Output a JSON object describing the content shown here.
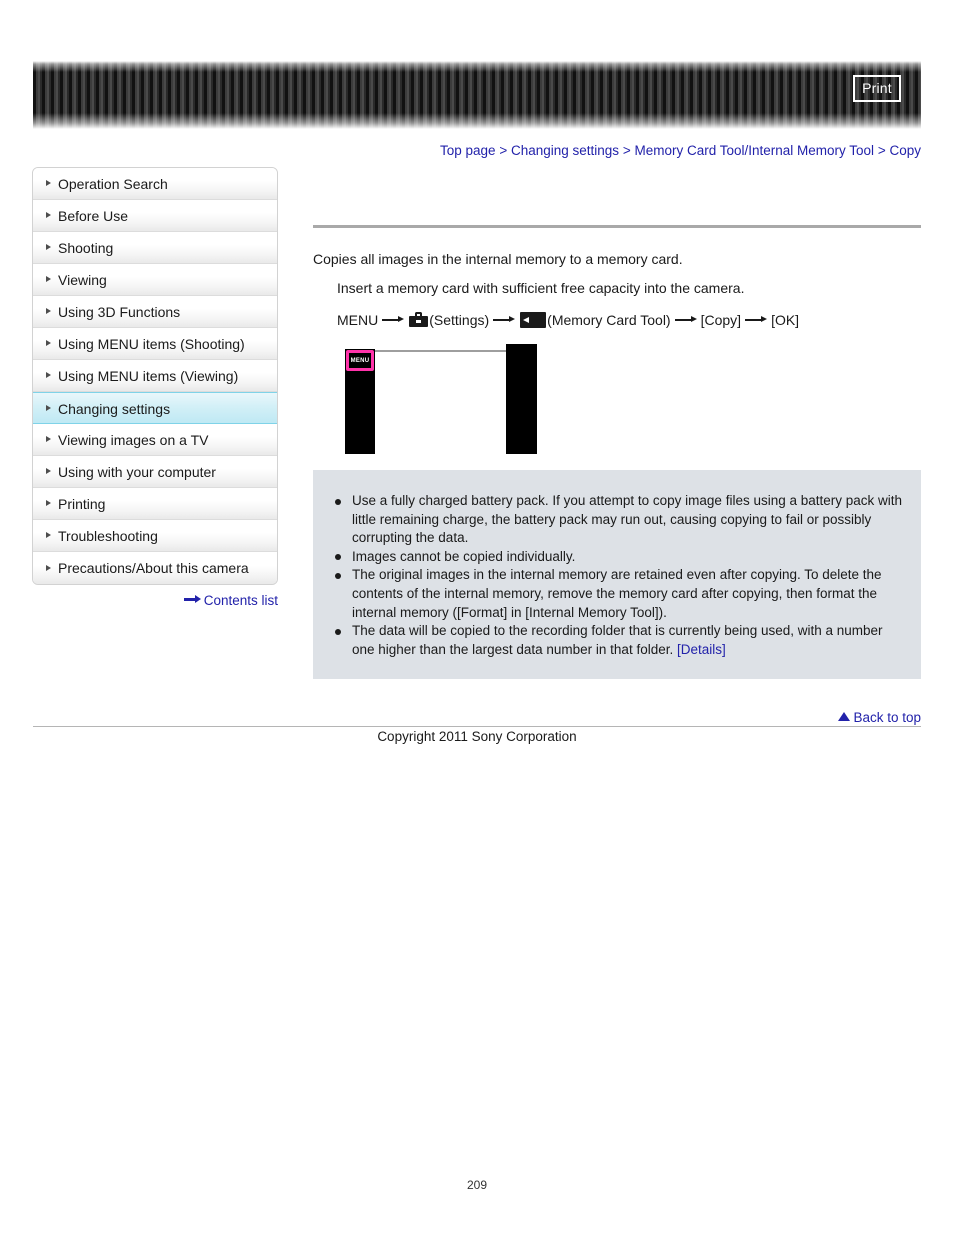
{
  "header": {
    "print_label": "Print"
  },
  "breadcrumb": {
    "items": [
      {
        "label": "Top page"
      },
      {
        "label": "Changing settings"
      },
      {
        "label": "Memory Card Tool/Internal Memory Tool"
      },
      {
        "label": "Copy"
      }
    ],
    "separator": ">"
  },
  "sidebar": {
    "items": [
      {
        "label": "Operation Search",
        "selected": false
      },
      {
        "label": "Before Use",
        "selected": false
      },
      {
        "label": "Shooting",
        "selected": false
      },
      {
        "label": "Viewing",
        "selected": false
      },
      {
        "label": "Using 3D Functions",
        "selected": false
      },
      {
        "label": "Using MENU items (Shooting)",
        "selected": false
      },
      {
        "label": "Using MENU items (Viewing)",
        "selected": false
      },
      {
        "label": "Changing settings",
        "selected": true
      },
      {
        "label": "Viewing images on a TV",
        "selected": false
      },
      {
        "label": "Using with your computer",
        "selected": false
      },
      {
        "label": "Printing",
        "selected": false
      },
      {
        "label": "Troubleshooting",
        "selected": false
      },
      {
        "label": "Precautions/About this camera",
        "selected": false
      }
    ],
    "contents_link": "Contents list"
  },
  "main": {
    "intro": "Copies all images in the internal memory to a memory card.",
    "instruction": "Insert a memory card with sufficient free capacity into the camera.",
    "menu_path": {
      "start": "MENU",
      "settings_label": "(Settings)",
      "memcard_label": "(Memory Card Tool)",
      "copy_label": "[Copy]",
      "ok_label": "[OK]",
      "settings_icon": "toolbox-settings-icon",
      "memcard_icon": "memory-card-tool-icon"
    },
    "illustration": {
      "menu_button_label": "MENU",
      "highlight_color": "#ff33aa"
    },
    "notes": [
      "Use a fully charged battery pack. If you attempt to copy image files using a battery pack with little remaining charge, the battery pack may run out, causing copying to fail or possibly corrupting the data.",
      "Images cannot be copied individually.",
      "The original images in the internal memory are retained even after copying. To delete the contents of the internal memory, remove the memory card after copying, then format the internal memory ([Format] in [Internal Memory Tool]).",
      "The data will be copied to the recording folder that is currently being used, with a number one higher than the largest data number in that folder."
    ],
    "details_link": "[Details]"
  },
  "footer": {
    "back_to_top": "Back to top",
    "copyright": "Copyright 2011 Sony Corporation",
    "page_number": "209"
  },
  "colors": {
    "link": "#2222aa",
    "selected_nav": "#bfe9f4",
    "notes_bg": "#dde1e6",
    "banner_dark": "#2e2e2e"
  }
}
